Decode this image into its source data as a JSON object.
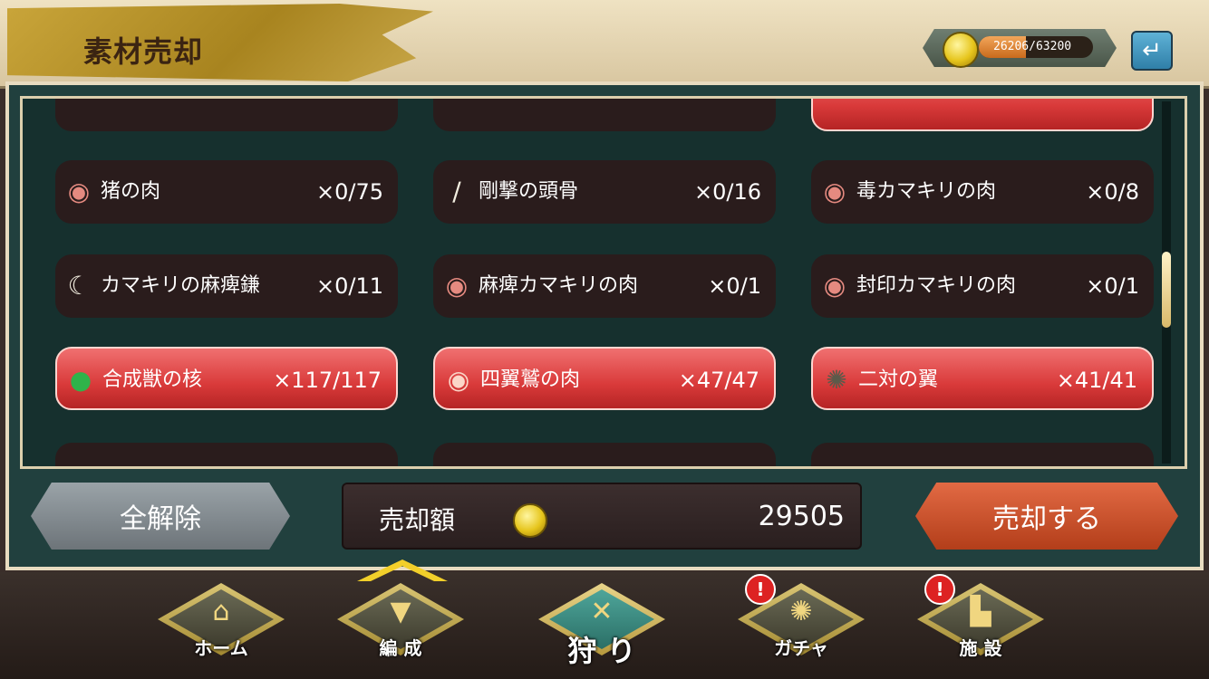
{
  "header": {
    "title": "素材売却",
    "coins_current": "26206",
    "coins_max": "63200",
    "coins_text": "26206/63200",
    "coins_fraction": 0.414,
    "back_icon": "back-arrow-icon"
  },
  "materials": [
    {
      "name": "猪の肉",
      "count": "×0/75",
      "icon": "meat-icon",
      "selected": false
    },
    {
      "name": "剛撃の頭骨",
      "count": "×0/16",
      "icon": "bone-icon",
      "selected": false
    },
    {
      "name": "毒カマキリの肉",
      "count": "×0/8",
      "icon": "meat-icon",
      "selected": false
    },
    {
      "name": "カマキリの麻痺鎌",
      "count": "×0/11",
      "icon": "claw-icon",
      "selected": false
    },
    {
      "name": "麻痺カマキリの肉",
      "count": "×0/1",
      "icon": "meat-icon",
      "selected": false
    },
    {
      "name": "封印カマキリの肉",
      "count": "×0/1",
      "icon": "meat-icon",
      "selected": false
    },
    {
      "name": "合成獣の核",
      "count": "×117/117",
      "icon": "green-orb-icon",
      "selected": true
    },
    {
      "name": "四翼鷲の肉",
      "count": "×47/47",
      "icon": "meat-icon",
      "selected": true
    },
    {
      "name": "二対の翼",
      "count": "×41/41",
      "icon": "wing-icon",
      "selected": true
    }
  ],
  "actions": {
    "clear_label": "全解除",
    "amount_label": "売却額",
    "amount_value": "29505",
    "sell_label": "売却する"
  },
  "nav": [
    {
      "label": "ホーム",
      "icon": "home-gate-icon",
      "alert": false,
      "active": false
    },
    {
      "label": "編 成",
      "icon": "bird-mask-icon",
      "alert": false,
      "active": false
    },
    {
      "label": "狩 り",
      "icon": "crossed-swords-icon",
      "alert": false,
      "active": true
    },
    {
      "label": "ガチャ",
      "icon": "compass-wheel-icon",
      "alert": true,
      "active": false
    },
    {
      "label": "施 設",
      "icon": "castle-icon",
      "alert": true,
      "active": false
    }
  ],
  "alert_mark": "!"
}
